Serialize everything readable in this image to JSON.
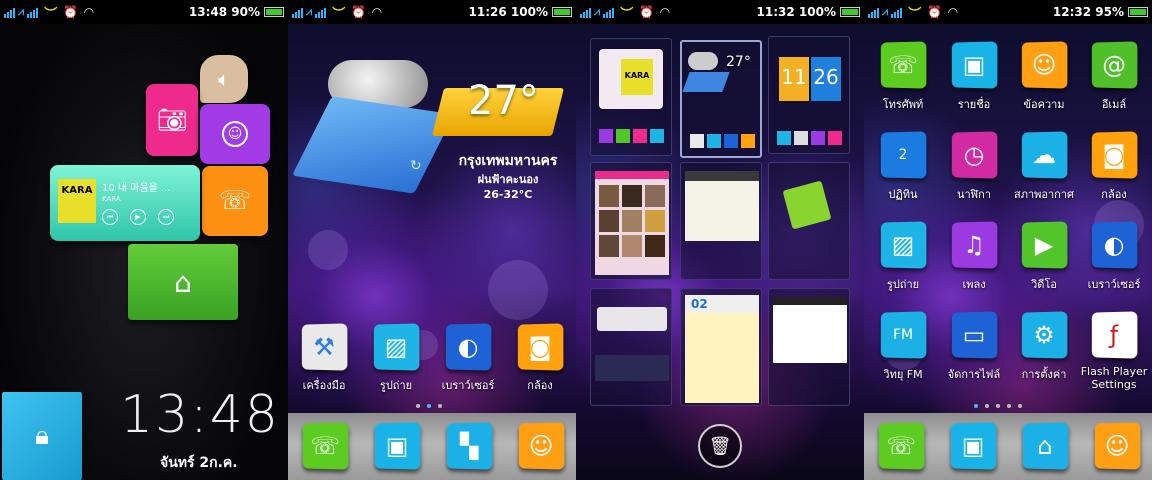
{
  "panels": [
    {
      "status": {
        "time": "13:48",
        "battery": "90%"
      },
      "music": {
        "title": "10 내 마음을 ...",
        "artist": "KARA",
        "album_art_text": "KARA"
      },
      "clock": "13:48",
      "date": "จันทร์ 2ก.ค."
    },
    {
      "status": {
        "time": "11:26",
        "battery": "100%"
      },
      "weather": {
        "temp": "27°",
        "city": "กรุงเทพมหานคร",
        "condition": "ฝนฟ้าคะนอง",
        "range": "26-32°C"
      },
      "apps": [
        {
          "label": "เครื่องมือ",
          "icon": "tools-icon",
          "color": "#e9e9e9"
        },
        {
          "label": "รูปถ่าย",
          "icon": "photo-icon",
          "color": "#1eb4e6"
        },
        {
          "label": "เบราว์เซอร์",
          "icon": "globe-icon",
          "color": "#1e63d6"
        },
        {
          "label": "กล้อง",
          "icon": "camera-icon",
          "color": "#ffa20e"
        }
      ]
    },
    {
      "status": {
        "time": "11:32",
        "battery": "100%"
      },
      "thumbs": {
        "weather_temp": "27°",
        "clock_h": "11",
        "clock_m": "26",
        "calendar_day": "02",
        "album_text": "KARA"
      }
    },
    {
      "status": {
        "time": "12:32",
        "battery": "95%"
      },
      "apps": [
        {
          "label": "โทรศัพท์",
          "icon": "phone-icon",
          "color": "#5ccc21"
        },
        {
          "label": "รายชื่อ",
          "icon": "contacts-icon",
          "color": "#1ab3e8"
        },
        {
          "label": "ข้อความ",
          "icon": "message-icon",
          "color": "#ff9f14"
        },
        {
          "label": "อีเมล์",
          "icon": "email-icon",
          "color": "#4fc02a"
        },
        {
          "label": "ปฏิทิน",
          "icon": "calendar-icon",
          "color": "#1c7be0",
          "badge": "2"
        },
        {
          "label": "นาฬิกา",
          "icon": "clock-icon",
          "color": "#d22aa3"
        },
        {
          "label": "สภาพอากาศ",
          "icon": "cloud-icon",
          "color": "#1bb1e6"
        },
        {
          "label": "กล้อง",
          "icon": "camera-icon",
          "color": "#ffa20e"
        },
        {
          "label": "รูปถ่าย",
          "icon": "photo-icon",
          "color": "#1eb4e6"
        },
        {
          "label": "เพลง",
          "icon": "music-icon",
          "color": "#9a3ae0"
        },
        {
          "label": "วิดีโอ",
          "icon": "video-icon",
          "color": "#52c52a"
        },
        {
          "label": "เบราว์เซอร์",
          "icon": "globe-icon",
          "color": "#1e63d6"
        },
        {
          "label": "วิทยุ FM",
          "icon": "radio-icon",
          "color": "#1bb1e6",
          "badge": "FM"
        },
        {
          "label": "จัดการไฟล์",
          "icon": "folder-icon",
          "color": "#1e63d6"
        },
        {
          "label": "การตั้งค่า",
          "icon": "settings-icon",
          "color": "#1bb1e6"
        },
        {
          "label": "Flash Player Settings",
          "icon": "flash-icon",
          "color": "#ffffff"
        }
      ]
    }
  ],
  "dock": [
    {
      "icon": "phone-icon",
      "color": "#5ccc21"
    },
    {
      "icon": "app-drawer-icon",
      "color": "#1ab3e8"
    },
    {
      "icon": "widgets-icon",
      "color": "#1bb1e6"
    },
    {
      "icon": "message-icon",
      "color": "#ff9f14"
    }
  ],
  "dock4": [
    {
      "icon": "phone-icon",
      "color": "#5ccc21"
    },
    {
      "icon": "app-drawer-icon",
      "color": "#1ab3e8"
    },
    {
      "icon": "home-icon",
      "color": "#1bb1e6"
    },
    {
      "icon": "message-icon",
      "color": "#ff9f14"
    }
  ]
}
